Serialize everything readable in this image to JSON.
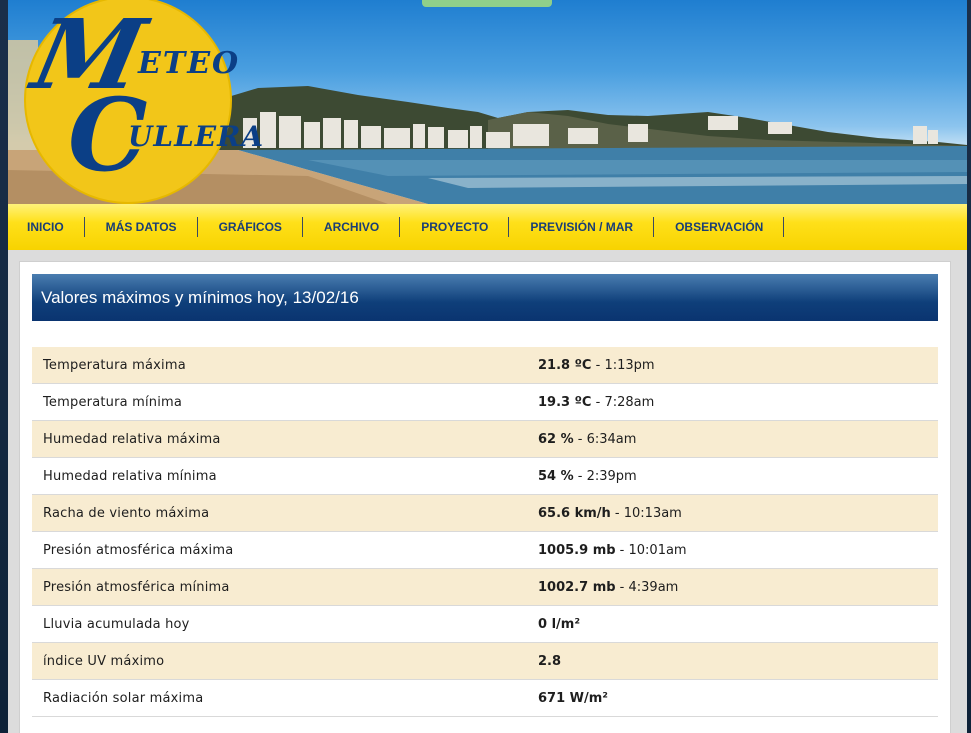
{
  "header": {
    "logo_line1": "ETEO",
    "logo_line2": "ULLERA",
    "logo_m": "M",
    "logo_c": "C"
  },
  "nav": {
    "items": [
      {
        "label": "INICIO"
      },
      {
        "label": "MÁS DATOS"
      },
      {
        "label": "GRÁFICOS"
      },
      {
        "label": "ARCHIVO"
      },
      {
        "label": "PROYECTO"
      },
      {
        "label": "PREVISIÓN / MAR"
      },
      {
        "label": "OBSERVACIÓN"
      }
    ]
  },
  "panel": {
    "title": "Valores máximos y mínimos hoy, 13/02/16"
  },
  "records": [
    {
      "label": "Temperatura máxima",
      "value": "21.8 ºC",
      "time": " - 1:13pm"
    },
    {
      "label": "Temperatura mínima",
      "value": "19.3 ºC",
      "time": " - 7:28am"
    },
    {
      "label": "Humedad relativa máxima",
      "value": "62 %",
      "time": " - 6:34am"
    },
    {
      "label": "Humedad relativa mínima",
      "value": "54 %",
      "time": " - 2:39pm"
    },
    {
      "label": "Racha de viento máxima",
      "value": "65.6 km/h",
      "time": " - 10:13am"
    },
    {
      "label": "Presión atmosférica máxima",
      "value": "1005.9 mb",
      "time": " - 10:01am"
    },
    {
      "label": "Presión atmosférica mínima",
      "value": "1002.7 mb",
      "time": " - 4:39am"
    },
    {
      "label": "Lluvia acumulada hoy",
      "value": "0 l/m²",
      "time": ""
    },
    {
      "label": "índice UV máximo",
      "value": "2.8",
      "time": ""
    },
    {
      "label": "Radiación solar máxima",
      "value": "671 W/m²",
      "time": ""
    }
  ],
  "colors": {
    "nav_text": "#1a3e75",
    "row_alt": "#f8ecd1",
    "title_bar": "#0f3f7a",
    "logo_yellow": "#f2c619",
    "logo_blue": "#0b3f86"
  }
}
